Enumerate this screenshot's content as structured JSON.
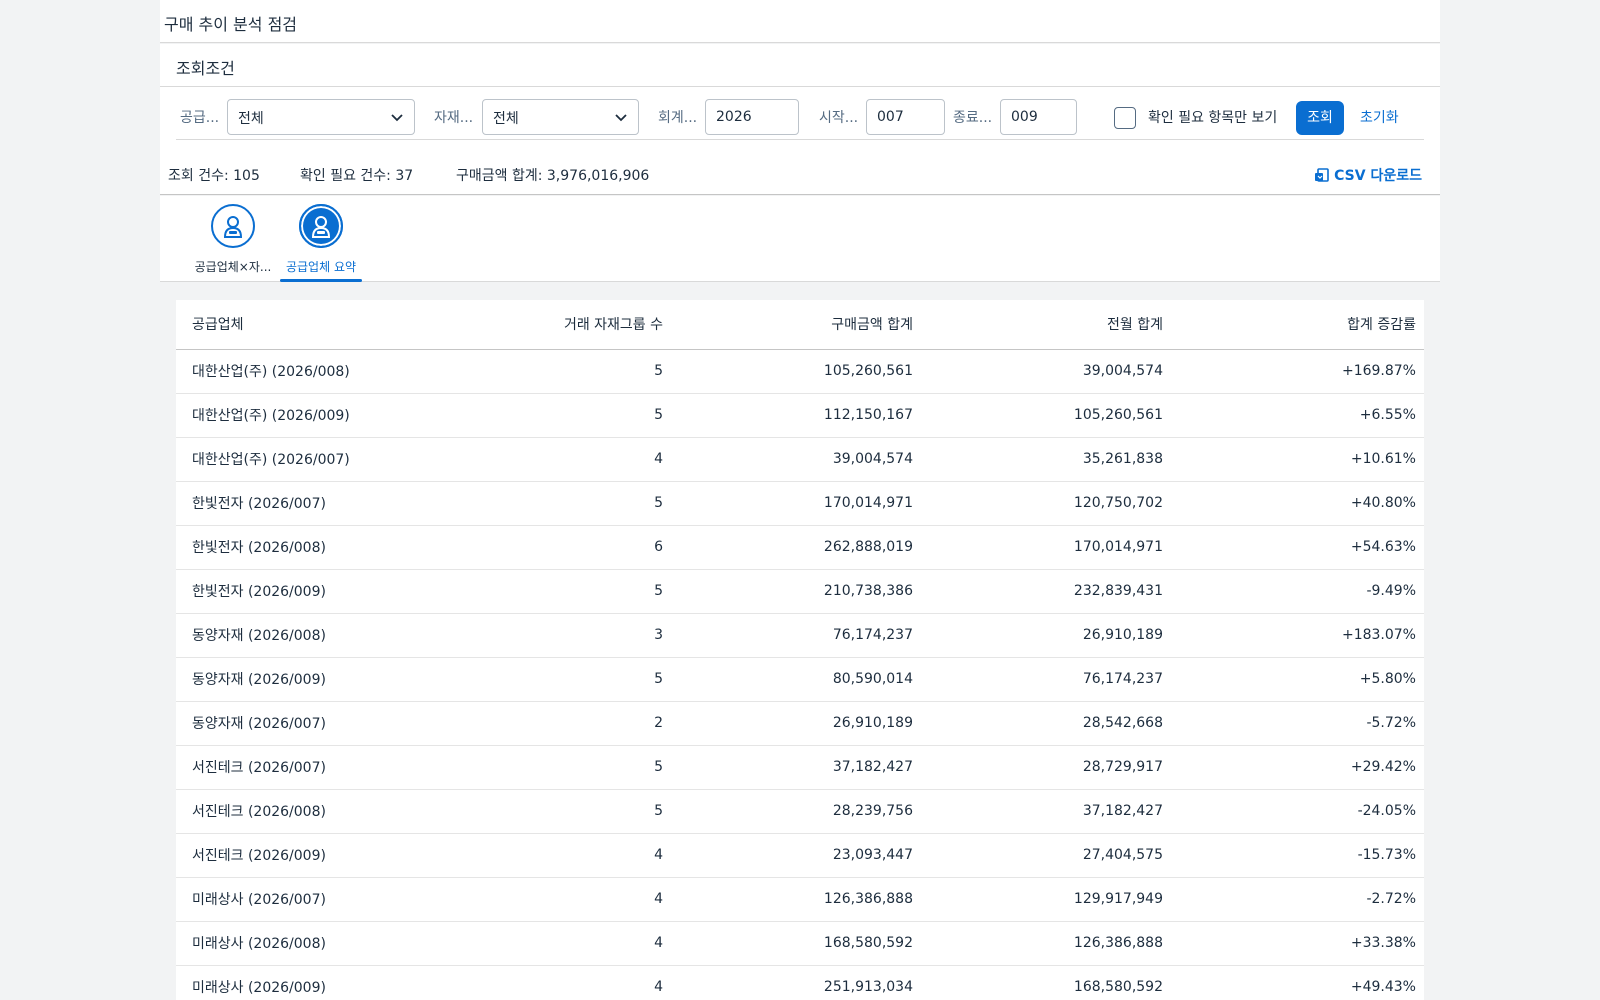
{
  "app": {
    "title": "구매 추이 분석 점검"
  },
  "filters": {
    "header": "조회조건",
    "supplier": {
      "label": "공급...",
      "value": "전체"
    },
    "material": {
      "label": "자재...",
      "value": "전체"
    },
    "fiscal_year": {
      "label": "회계...",
      "value": "2026"
    },
    "start_period": {
      "label": "시작...",
      "value": "007"
    },
    "end_period": {
      "label": "종료...",
      "value": "009"
    },
    "only_check_label": "확인 필요 항목만 보기",
    "query_label": "조회",
    "reset_label": "초기화"
  },
  "summary": {
    "count": "조회 건수: 105",
    "check_count": "확인 필요 건수: 37",
    "amount_total": "구매금액 합계: 3,976,016,906",
    "csv_label": "CSV 다운로드"
  },
  "tabs": [
    {
      "label": "공급업체×자...",
      "icon": "person-icon"
    },
    {
      "label": "공급업체 요약",
      "icon": "person-icon"
    }
  ],
  "accent": "#0a6ed1",
  "table": {
    "columns": [
      "공급업체",
      "거래 자재그룹 수",
      "구매금액 합계",
      "전월 합계",
      "합계 증감률"
    ],
    "rows": [
      [
        "대한산업(주) (2026/008)",
        "5",
        "105,260,561",
        "39,004,574",
        "+169.87%"
      ],
      [
        "대한산업(주) (2026/009)",
        "5",
        "112,150,167",
        "105,260,561",
        "+6.55%"
      ],
      [
        "대한산업(주) (2026/007)",
        "4",
        "39,004,574",
        "35,261,838",
        "+10.61%"
      ],
      [
        "한빛전자 (2026/007)",
        "5",
        "170,014,971",
        "120,750,702",
        "+40.80%"
      ],
      [
        "한빛전자 (2026/008)",
        "6",
        "262,888,019",
        "170,014,971",
        "+54.63%"
      ],
      [
        "한빛전자 (2026/009)",
        "5",
        "210,738,386",
        "232,839,431",
        "-9.49%"
      ],
      [
        "동양자재 (2026/008)",
        "3",
        "76,174,237",
        "26,910,189",
        "+183.07%"
      ],
      [
        "동양자재 (2026/009)",
        "5",
        "80,590,014",
        "76,174,237",
        "+5.80%"
      ],
      [
        "동양자재 (2026/007)",
        "2",
        "26,910,189",
        "28,542,668",
        "-5.72%"
      ],
      [
        "서진테크 (2026/007)",
        "5",
        "37,182,427",
        "28,729,917",
        "+29.42%"
      ],
      [
        "서진테크 (2026/008)",
        "5",
        "28,239,756",
        "37,182,427",
        "-24.05%"
      ],
      [
        "서진테크 (2026/009)",
        "4",
        "23,093,447",
        "27,404,575",
        "-15.73%"
      ],
      [
        "미래상사 (2026/007)",
        "4",
        "126,386,888",
        "129,917,949",
        "-2.72%"
      ],
      [
        "미래상사 (2026/008)",
        "4",
        "168,580,592",
        "126,386,888",
        "+33.38%"
      ],
      [
        "미래상사 (2026/009)",
        "4",
        "251,913,034",
        "168,580,592",
        "+49.43%"
      ]
    ]
  }
}
